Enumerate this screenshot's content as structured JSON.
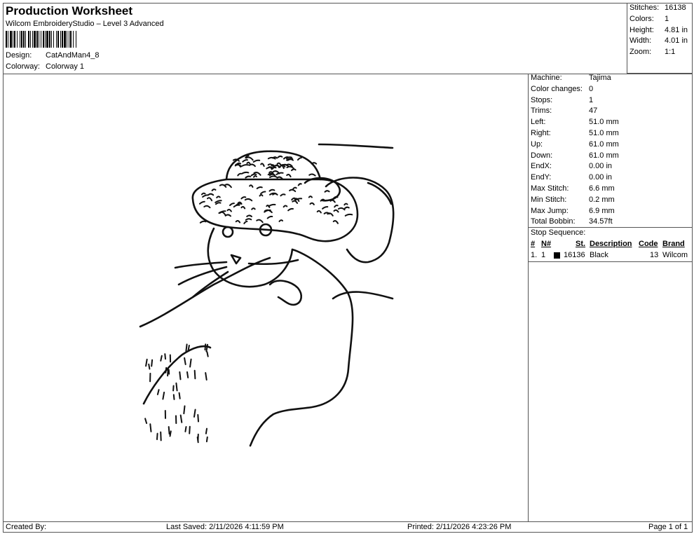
{
  "header": {
    "title": "Production Worksheet",
    "subtitle": "Wilcom EmbroideryStudio – Level 3 Advanced",
    "design_label": "Design:",
    "design_value": "CatAndMan4_8",
    "colorway_label": "Colorway:",
    "colorway_value": "Colorway 1"
  },
  "stats": {
    "stitches_label": "Stitches:",
    "stitches_value": "16138",
    "colors_label": "Colors:",
    "colors_value": "1",
    "height_label": "Height:",
    "height_value": "4.81 in",
    "width_label": "Width:",
    "width_value": "4.01 in",
    "zoom_label": "Zoom:",
    "zoom_value": "1:1"
  },
  "machine_info": [
    {
      "label": "Machine:",
      "value": "Tajima"
    },
    {
      "label": "Color changes:",
      "value": "0"
    },
    {
      "label": "Stops:",
      "value": "1"
    },
    {
      "label": "Trims:",
      "value": "47"
    },
    {
      "label": "Left:",
      "value": "51.0 mm"
    },
    {
      "label": "Right:",
      "value": "51.0 mm"
    },
    {
      "label": "Up:",
      "value": "61.0 mm"
    },
    {
      "label": "Down:",
      "value": "61.0 mm"
    },
    {
      "label": "EndX:",
      "value": "0.00 in"
    },
    {
      "label": "EndY:",
      "value": "0.00 in"
    },
    {
      "label": "Max Stitch:",
      "value": "6.6 mm"
    },
    {
      "label": "Min Stitch:",
      "value": "0.2 mm"
    },
    {
      "label": "Max Jump:",
      "value": "6.9 mm"
    },
    {
      "label": "Total Bobbin:",
      "value": "34.57ft"
    }
  ],
  "stop_sequence": {
    "title": "Stop Sequence:",
    "headers": {
      "num": "#",
      "n": "N#",
      "st": "St.",
      "description": "Description",
      "code": "Code",
      "brand": "Brand"
    },
    "rows": [
      {
        "num": "1.",
        "n": "1",
        "swatch_color": "#000000",
        "st": "16136",
        "description": "Black",
        "code": "13",
        "brand": "Wilcom"
      }
    ]
  },
  "footer": {
    "created_by": "Created By:",
    "last_saved": "Last Saved: 2/11/2026 4:11:59 PM",
    "printed": "Printed: 2/11/2026 4:23:26 PM",
    "page": "Page 1 of 1"
  }
}
